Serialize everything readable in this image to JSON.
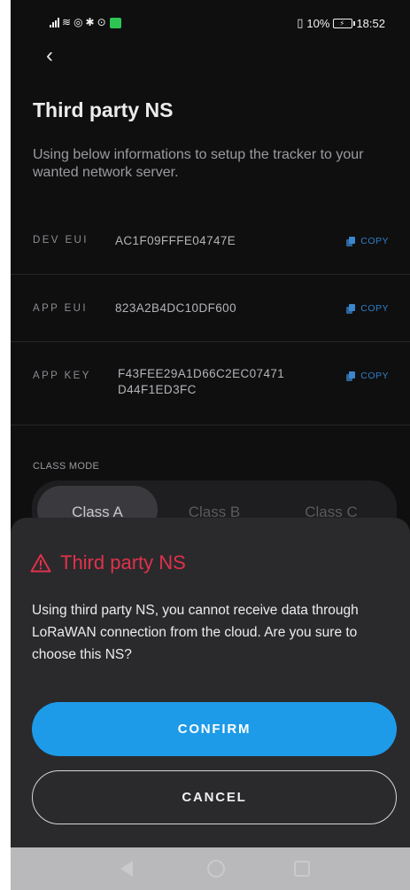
{
  "status": {
    "battery_percent": "10%",
    "time": "18:52",
    "icons": [
      "signal-icon",
      "wifi-icon",
      "hotspot-icon",
      "bluetooth-icon",
      "location-icon",
      "app-notification-icon"
    ],
    "right_icons": [
      "vibrate-icon",
      "battery-charging-icon"
    ]
  },
  "header": {
    "back_icon": "chevron-left-icon",
    "title": "Third party NS",
    "description": "Using below informations to setup the tracker to your wanted network server."
  },
  "credentials": [
    {
      "label": "DEV EUI",
      "value": "AC1F09FFFE04747E",
      "copy_label": "COPY"
    },
    {
      "label": "APP EUI",
      "value": "823A2B4DC10DF600",
      "copy_label": "COPY"
    },
    {
      "label": "APP KEY",
      "value": "F43FEE29A1D66C2EC07471\nD44F1ED3FC",
      "copy_label": "COPY"
    }
  ],
  "class_mode": {
    "label": "CLASS MODE",
    "options": [
      "Class A",
      "Class B",
      "Class C"
    ],
    "selected": "Class A"
  },
  "dialog": {
    "title": "Third party NS",
    "warning_icon": "warning-triangle-icon",
    "message": "Using third party NS, you cannot receive data through LoRaWAN connection from the cloud. Are you sure to choose this NS?",
    "confirm_label": "CONFIRM",
    "cancel_label": "CANCEL"
  },
  "colors": {
    "accent": "#1e9be8",
    "warning": "#e0314b",
    "copy": "#2f7fc8",
    "background": "#0f0f10",
    "sheet": "#2a2a2c"
  }
}
